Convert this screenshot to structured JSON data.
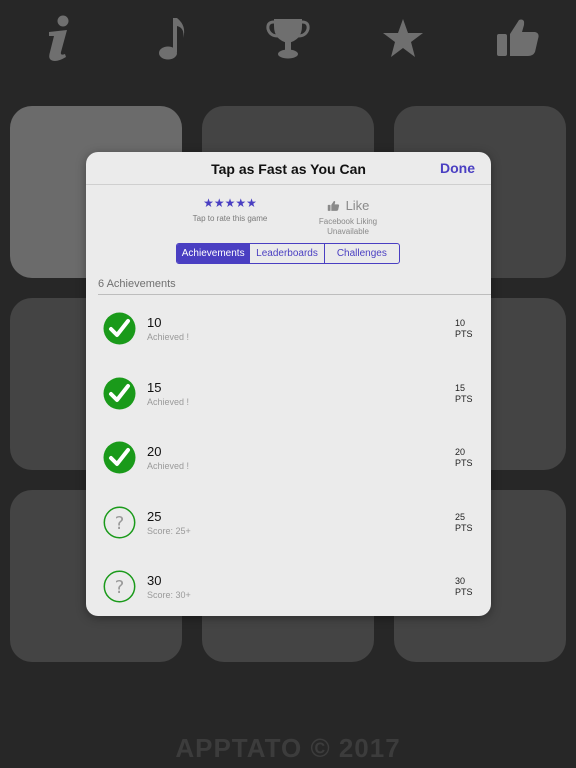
{
  "topbar": {
    "icons": [
      "info-icon",
      "music-note-icon",
      "trophy-icon",
      "star-icon",
      "thumbs-up-icon"
    ]
  },
  "footer": {
    "text": "APPTATO © 2017"
  },
  "modal": {
    "title": "Tap as Fast as You Can",
    "done_label": "Done",
    "rating": {
      "stars": "★★★★★",
      "caption": "Tap to rate this game"
    },
    "like": {
      "label": "Like",
      "caption_line1": "Facebook Liking",
      "caption_line2": "Unavailable"
    },
    "tabs": [
      {
        "label": "Achievements",
        "active": true
      },
      {
        "label": "Leaderboards",
        "active": false
      },
      {
        "label": "Challenges",
        "active": false
      }
    ],
    "achievements_count": "6 Achievements",
    "achievements": [
      {
        "name": "10",
        "subtitle": "Achieved !",
        "pts": "10",
        "pts_unit": "PTS",
        "achieved": true
      },
      {
        "name": "15",
        "subtitle": "Achieved !",
        "pts": "15",
        "pts_unit": "PTS",
        "achieved": true
      },
      {
        "name": "20",
        "subtitle": "Achieved !",
        "pts": "20",
        "pts_unit": "PTS",
        "achieved": true
      },
      {
        "name": "25",
        "subtitle": "Score: 25+",
        "pts": "25",
        "pts_unit": "PTS",
        "achieved": false
      },
      {
        "name": "30",
        "subtitle": "Score: 30+",
        "pts": "30",
        "pts_unit": "PTS",
        "achieved": false
      }
    ]
  },
  "colors": {
    "background": "#272727",
    "tile": "#444444",
    "tile_light": "#6b6b6b",
    "accent": "#4a3fc2",
    "achieved_green": "#1a9a1a"
  }
}
